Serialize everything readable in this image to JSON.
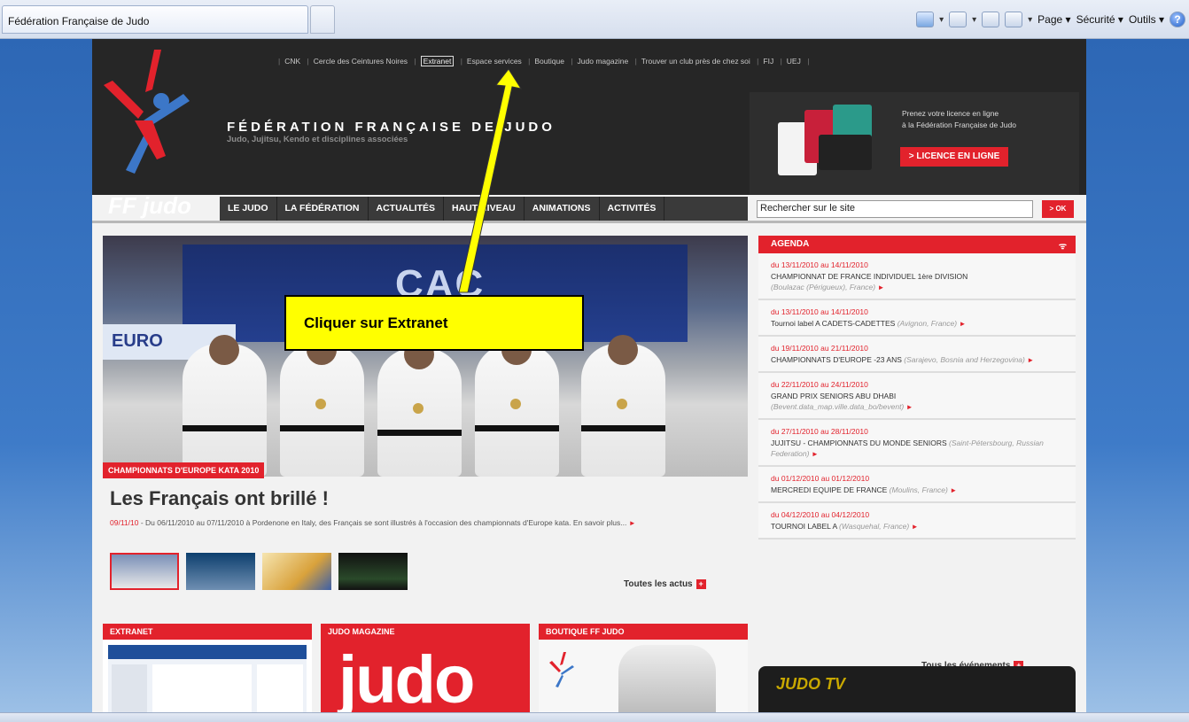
{
  "browser": {
    "tab_title": "Fédération Française de Judo",
    "menu_page": "Page",
    "menu_security": "Sécurité",
    "menu_tools": "Outils",
    "icons": [
      "home-icon",
      "rss-feed-icon",
      "mail-icon",
      "print-icon",
      "help-icon"
    ]
  },
  "header": {
    "top_links": [
      "CNK",
      "Cercle des Ceintures Noires",
      "Extranet",
      "Espace services",
      "Boutique",
      "Judo magazine",
      "Trouver un club près de chez soi",
      "FIJ",
      "UEJ"
    ],
    "federation_title": "FÉDÉRATION FRANÇAISE DE JUDO",
    "federation_subtitle": "Judo, Jujitsu, Kendo et disciplines associées",
    "logo_text": "FF judo",
    "promo_line1": "Prenez votre licence en ligne",
    "promo_line2": "à la Fédération Française de Judo",
    "licence_button": "> LICENCE EN LIGNE"
  },
  "nav": {
    "items": [
      "LE JUDO",
      "LA FÉDÉRATION",
      "ACTUALITÉS",
      "HAUT NIVEAU",
      "ANIMATIONS",
      "ACTIVITÉS"
    ],
    "search_placeholder": "Rechercher sur le site",
    "search_button": "> OK"
  },
  "hero": {
    "banner_text": "CAC",
    "euro_text": "EURO",
    "badge": "CHAMPIONNATS D'EUROPE KATA 2010",
    "title": "Les Français ont brillé !",
    "date": "09/11/10",
    "summary": " - Du 06/11/2010 au 07/11/2010 à Pordenone en Italy, des Français se sont illustrés à l'occasion des championnats d'Europe kata. En savoir plus...",
    "all_news": "Toutes les actus"
  },
  "agenda": {
    "title": "AGENDA",
    "items": [
      {
        "date": "du 13/11/2010 au 14/11/2010",
        "title": "CHAMPIONNAT DE FRANCE INDIVIDUEL 1ère DIVISION",
        "place": "(Boulazac (Périgueux), France)"
      },
      {
        "date": "du 13/11/2010 au 14/11/2010",
        "title": "Tournoi label A CADETS-CADETTES",
        "place": "(Avignon, France)"
      },
      {
        "date": "du 19/11/2010 au 21/11/2010",
        "title": "CHAMPIONNATS D'EUROPE -23 ANS",
        "place": "(Sarajevo, Bosnia and Herzegovina)"
      },
      {
        "date": "du 22/11/2010 au 24/11/2010",
        "title": "GRAND PRIX SENIORS ABU DHABI",
        "place": "(Bevent.data_map.ville.data_bo/bevent)"
      },
      {
        "date": "du 27/11/2010 au 28/11/2010",
        "title": "JUJITSU - CHAMPIONNATS DU MONDE SENIORS",
        "place": "(Saint-Pétersbourg, Russian Federation)"
      },
      {
        "date": "du 01/12/2010 au 01/12/2010",
        "title": "MERCREDI EQUIPE DE FRANCE",
        "place": "(Moulins, France)"
      },
      {
        "date": "du 04/12/2010 au 04/12/2010",
        "title": "TOURNOI LABEL A",
        "place": "(Wasquehal, France)"
      }
    ],
    "all_events": "Tous les événements"
  },
  "panels": {
    "extranet": "EXTRANET",
    "magazine": "JUDO MAGAZINE",
    "magazine_word": "judo",
    "boutique": "BOUTIQUE FF JUDO",
    "judo_tv": "JUDO TV"
  },
  "annotation": {
    "text": "Cliquer sur Extranet"
  },
  "colors": {
    "accent_red": "#e2222c",
    "header_dark": "#262626",
    "annotation_yellow": "#ffff00"
  }
}
